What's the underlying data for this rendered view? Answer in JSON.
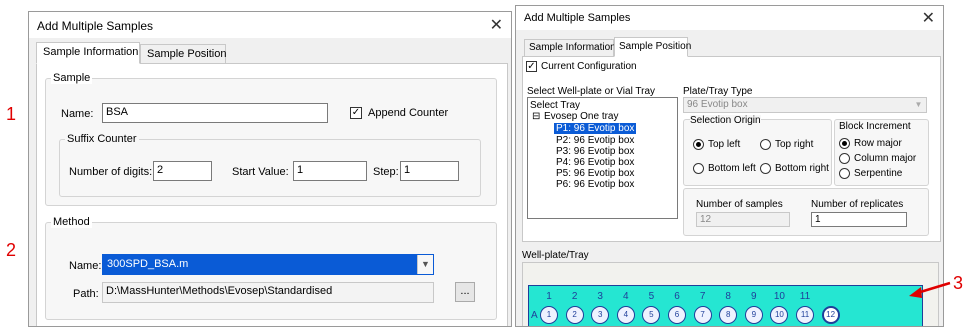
{
  "annotations": [
    "1",
    "2",
    "3"
  ],
  "left_window": {
    "title": "Add Multiple Samples",
    "close_glyph": "✕",
    "tabs": [
      "Sample Information",
      "Sample Position"
    ],
    "sample_group": {
      "label": "Sample",
      "name_label": "Name:",
      "name_value": "BSA",
      "append_counter_label": "Append Counter",
      "append_counter_checked": true,
      "suffix_counter": {
        "label": "Suffix Counter",
        "digits_label": "Number of digits:",
        "digits_value": "2",
        "start_label": "Start Value:",
        "start_value": "1",
        "step_label": "Step:",
        "step_value": "1"
      }
    },
    "method_group": {
      "label": "Method",
      "name_label": "Name:",
      "name_value": "300SPD_BSA.m",
      "path_label": "Path:",
      "path_value": "D:\\MassHunter\\Methods\\Evosep\\Standardised",
      "browse_label": "..."
    }
  },
  "right_window": {
    "title": "Add Multiple Samples",
    "close_glyph": "✕",
    "tabs": [
      "Sample Information",
      "Sample Position"
    ],
    "current_config_label": "Current Configuration",
    "current_config_checked": true,
    "select_tray_label": "Select Well-plate or Vial Tray",
    "tree": {
      "root": "Select Tray",
      "expander": "⊟",
      "group": "Evosep One tray",
      "items": [
        "P1: 96 Evotip box",
        "P2: 96 Evotip box",
        "P3: 96 Evotip box",
        "P4: 96 Evotip box",
        "P5: 96 Evotip box",
        "P6: 96 Evotip box"
      ],
      "selected_index": 0
    },
    "plate_type_label": "Plate/Tray Type",
    "plate_type_value": "96 Evotip box",
    "selection_origin": {
      "label": "Selection Origin",
      "options": [
        "Top left",
        "Top right",
        "Bottom left",
        "Bottom right"
      ],
      "selected": "Top left"
    },
    "block_increment": {
      "label": "Block Increment",
      "options": [
        "Row major",
        "Column major",
        "Serpentine"
      ],
      "selected": "Row major"
    },
    "num_samples_label": "Number of samples",
    "num_samples_value": "12",
    "num_replicates_label": "Number of replicates",
    "num_replicates_value": "1",
    "wellplate_label": "Well-plate/Tray",
    "plate": {
      "columns": [
        "1",
        "2",
        "3",
        "4",
        "5",
        "6",
        "7",
        "8",
        "9",
        "10",
        "11"
      ],
      "row_label": "A",
      "wells": [
        "1",
        "2",
        "3",
        "4",
        "5",
        "6",
        "7",
        "8",
        "9",
        "10",
        "11",
        "12"
      ]
    }
  },
  "colors": {
    "annotation": "#e00000",
    "selection": "#0a5bd6",
    "plate_background": "#25e6d2",
    "well": "#1f3f9a"
  }
}
